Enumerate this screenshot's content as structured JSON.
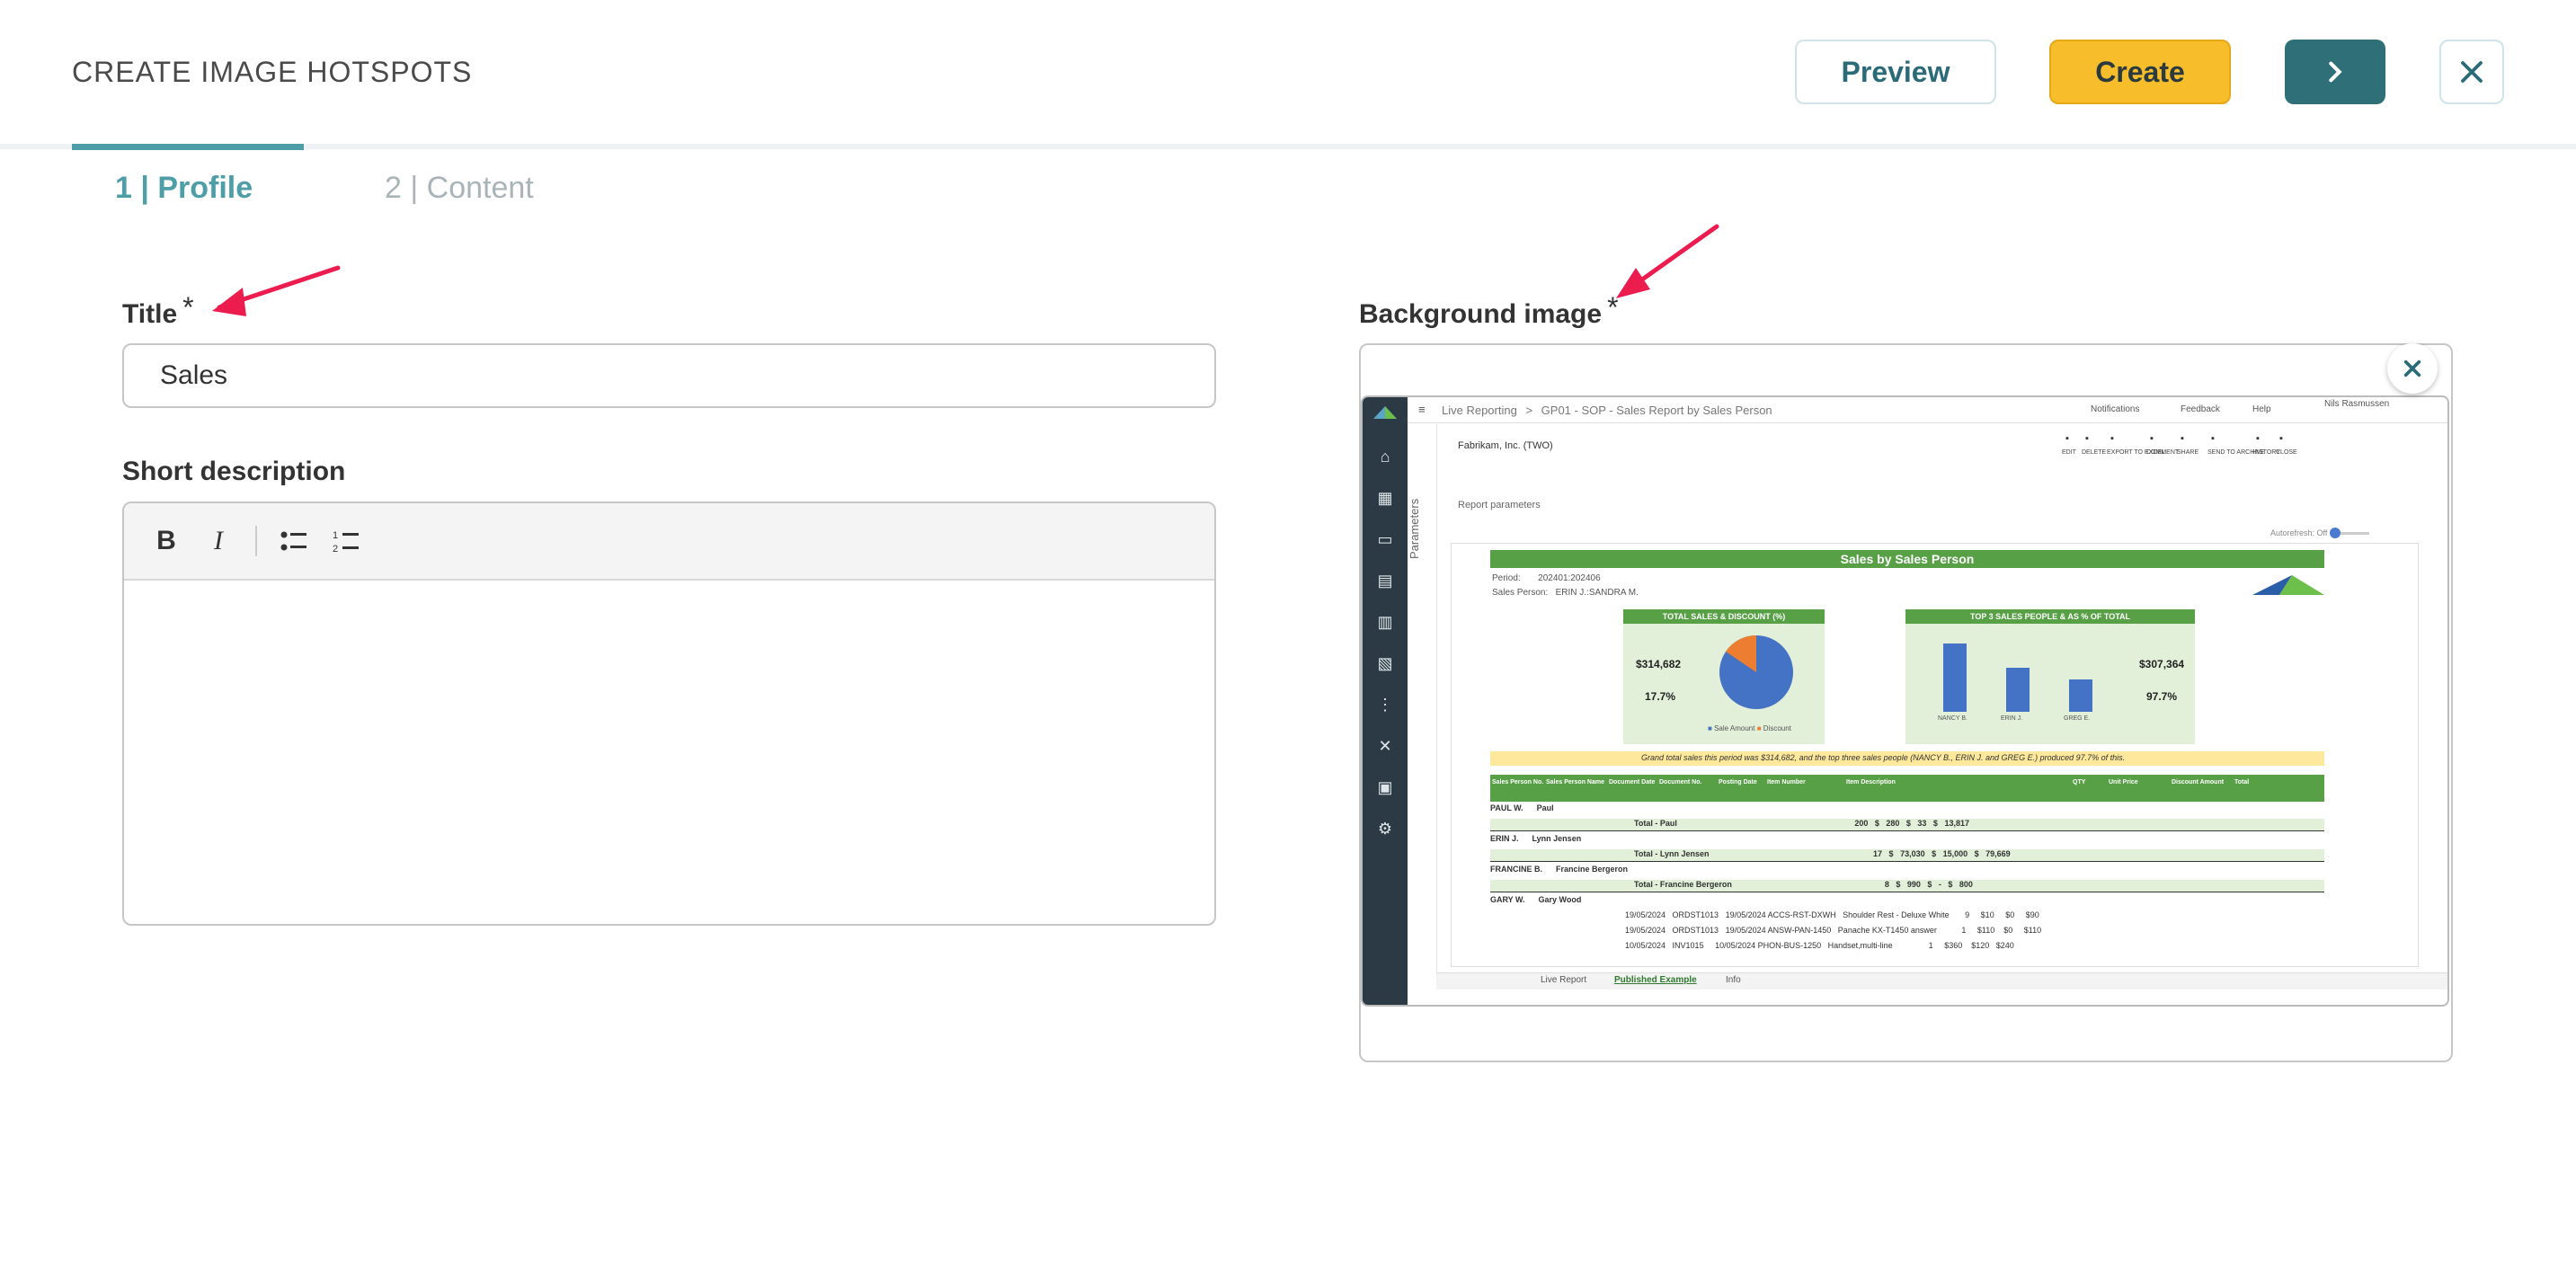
{
  "header": {
    "title": "CREATE IMAGE HOTSPOTS",
    "preview_label": "Preview",
    "create_label": "Create",
    "next_icon": "chevron-right-icon",
    "close_icon": "close-icon"
  },
  "tabs": [
    {
      "label": "1 | Profile",
      "active": true
    },
    {
      "label": "2 | Content",
      "active": false
    }
  ],
  "form": {
    "title_label": "Title",
    "title_required": "*",
    "title_value": "Sales",
    "short_description_label": "Short description",
    "editor_tools": [
      "B",
      "I",
      "bullet-list-icon",
      "numbered-list-icon"
    ],
    "background_image_label": "Background image",
    "background_image_required": "*"
  },
  "screenshot": {
    "breadcrumb_root": "Live Reporting",
    "breadcrumb_sep": ">",
    "breadcrumb_page": "GP01 - SOP - Sales Report by Sales Person",
    "notifications": "Notifications",
    "feedback": "Feedback",
    "help": "Help",
    "user": "Nils Rasmussen",
    "company": "Fabrikam, Inc. (TWO)",
    "parameters": "Parameters",
    "report_parameters": "Report parameters",
    "autorefresh": "Autorefresh: Off",
    "actions": [
      "EDIT",
      "DELETE",
      "EXPORT TO EXCEL",
      "COMMENT",
      "SHARE",
      "SEND TO ARCHIVE",
      "HISTORY",
      "CLOSE"
    ],
    "report_title": "Sales by Sales Person",
    "period_label": "Period:",
    "period_value": "202401:202406",
    "sales_person_label": "Sales Person:",
    "sales_person_value": "ERIN J.:SANDRA M.",
    "pie_title": "TOTAL SALES & DISCOUNT (%)",
    "pie_total": "$314,682",
    "pie_pct": "17.7%",
    "pie_legend_sales": "Sale Amount",
    "pie_legend_discount": "Discount",
    "bar_title": "TOP 3 SALES PEOPLE & AS % OF TOTAL",
    "bar_total": "$307,364",
    "bar_pct": "97.7%",
    "bar_names": [
      "NANCY B.",
      "ERIN J.",
      "GREG E."
    ],
    "bar_values": [
      100,
      65,
      47
    ],
    "summary": "Grand total sales this period was $314,682, and the top three sales people (NANCY B., ERIN J. and GREG E.) produced 97.7% of this.",
    "columns": [
      "Sales Person No.",
      "Sales Person Name",
      "Document Date",
      "Document No.",
      "Posting Date",
      "Item Number",
      "Item Description",
      "QTY",
      "Unit Price",
      "Discount Amount",
      "Total"
    ],
    "rows": [
      "PAUL W.      Paul",
      "Total - Paul                                                                               200   $   280   $   33   $   13,817",
      "ERIN J.      Lynn Jensen",
      "Total - Lynn Jensen                                                                         17   $   73,030   $   15,000   $   79,669",
      "FRANCINE B.      Francine Bergeron",
      "Total - Francine Bergeron                                                                    8   $   990   $   -   $   800",
      "GARY W.      Gary Wood",
      "19/05/2024   ORDST1013   19/05/2024 ACCS-RST-DXWH   Shoulder Rest - Deluxe White       9     $10     $0     $90",
      "19/05/2024   ORDST1013   19/05/2024 ANSW-PAN-1450   Panache KX-T1450 answer           1     $110    $0     $110",
      "10/05/2024   INV1015     10/05/2024 PHON-BUS-1250   Handset,multi-line                1     $360    $120   $240"
    ],
    "sheet_tabs": [
      "Live Report",
      "Published Example",
      "Info"
    ]
  }
}
